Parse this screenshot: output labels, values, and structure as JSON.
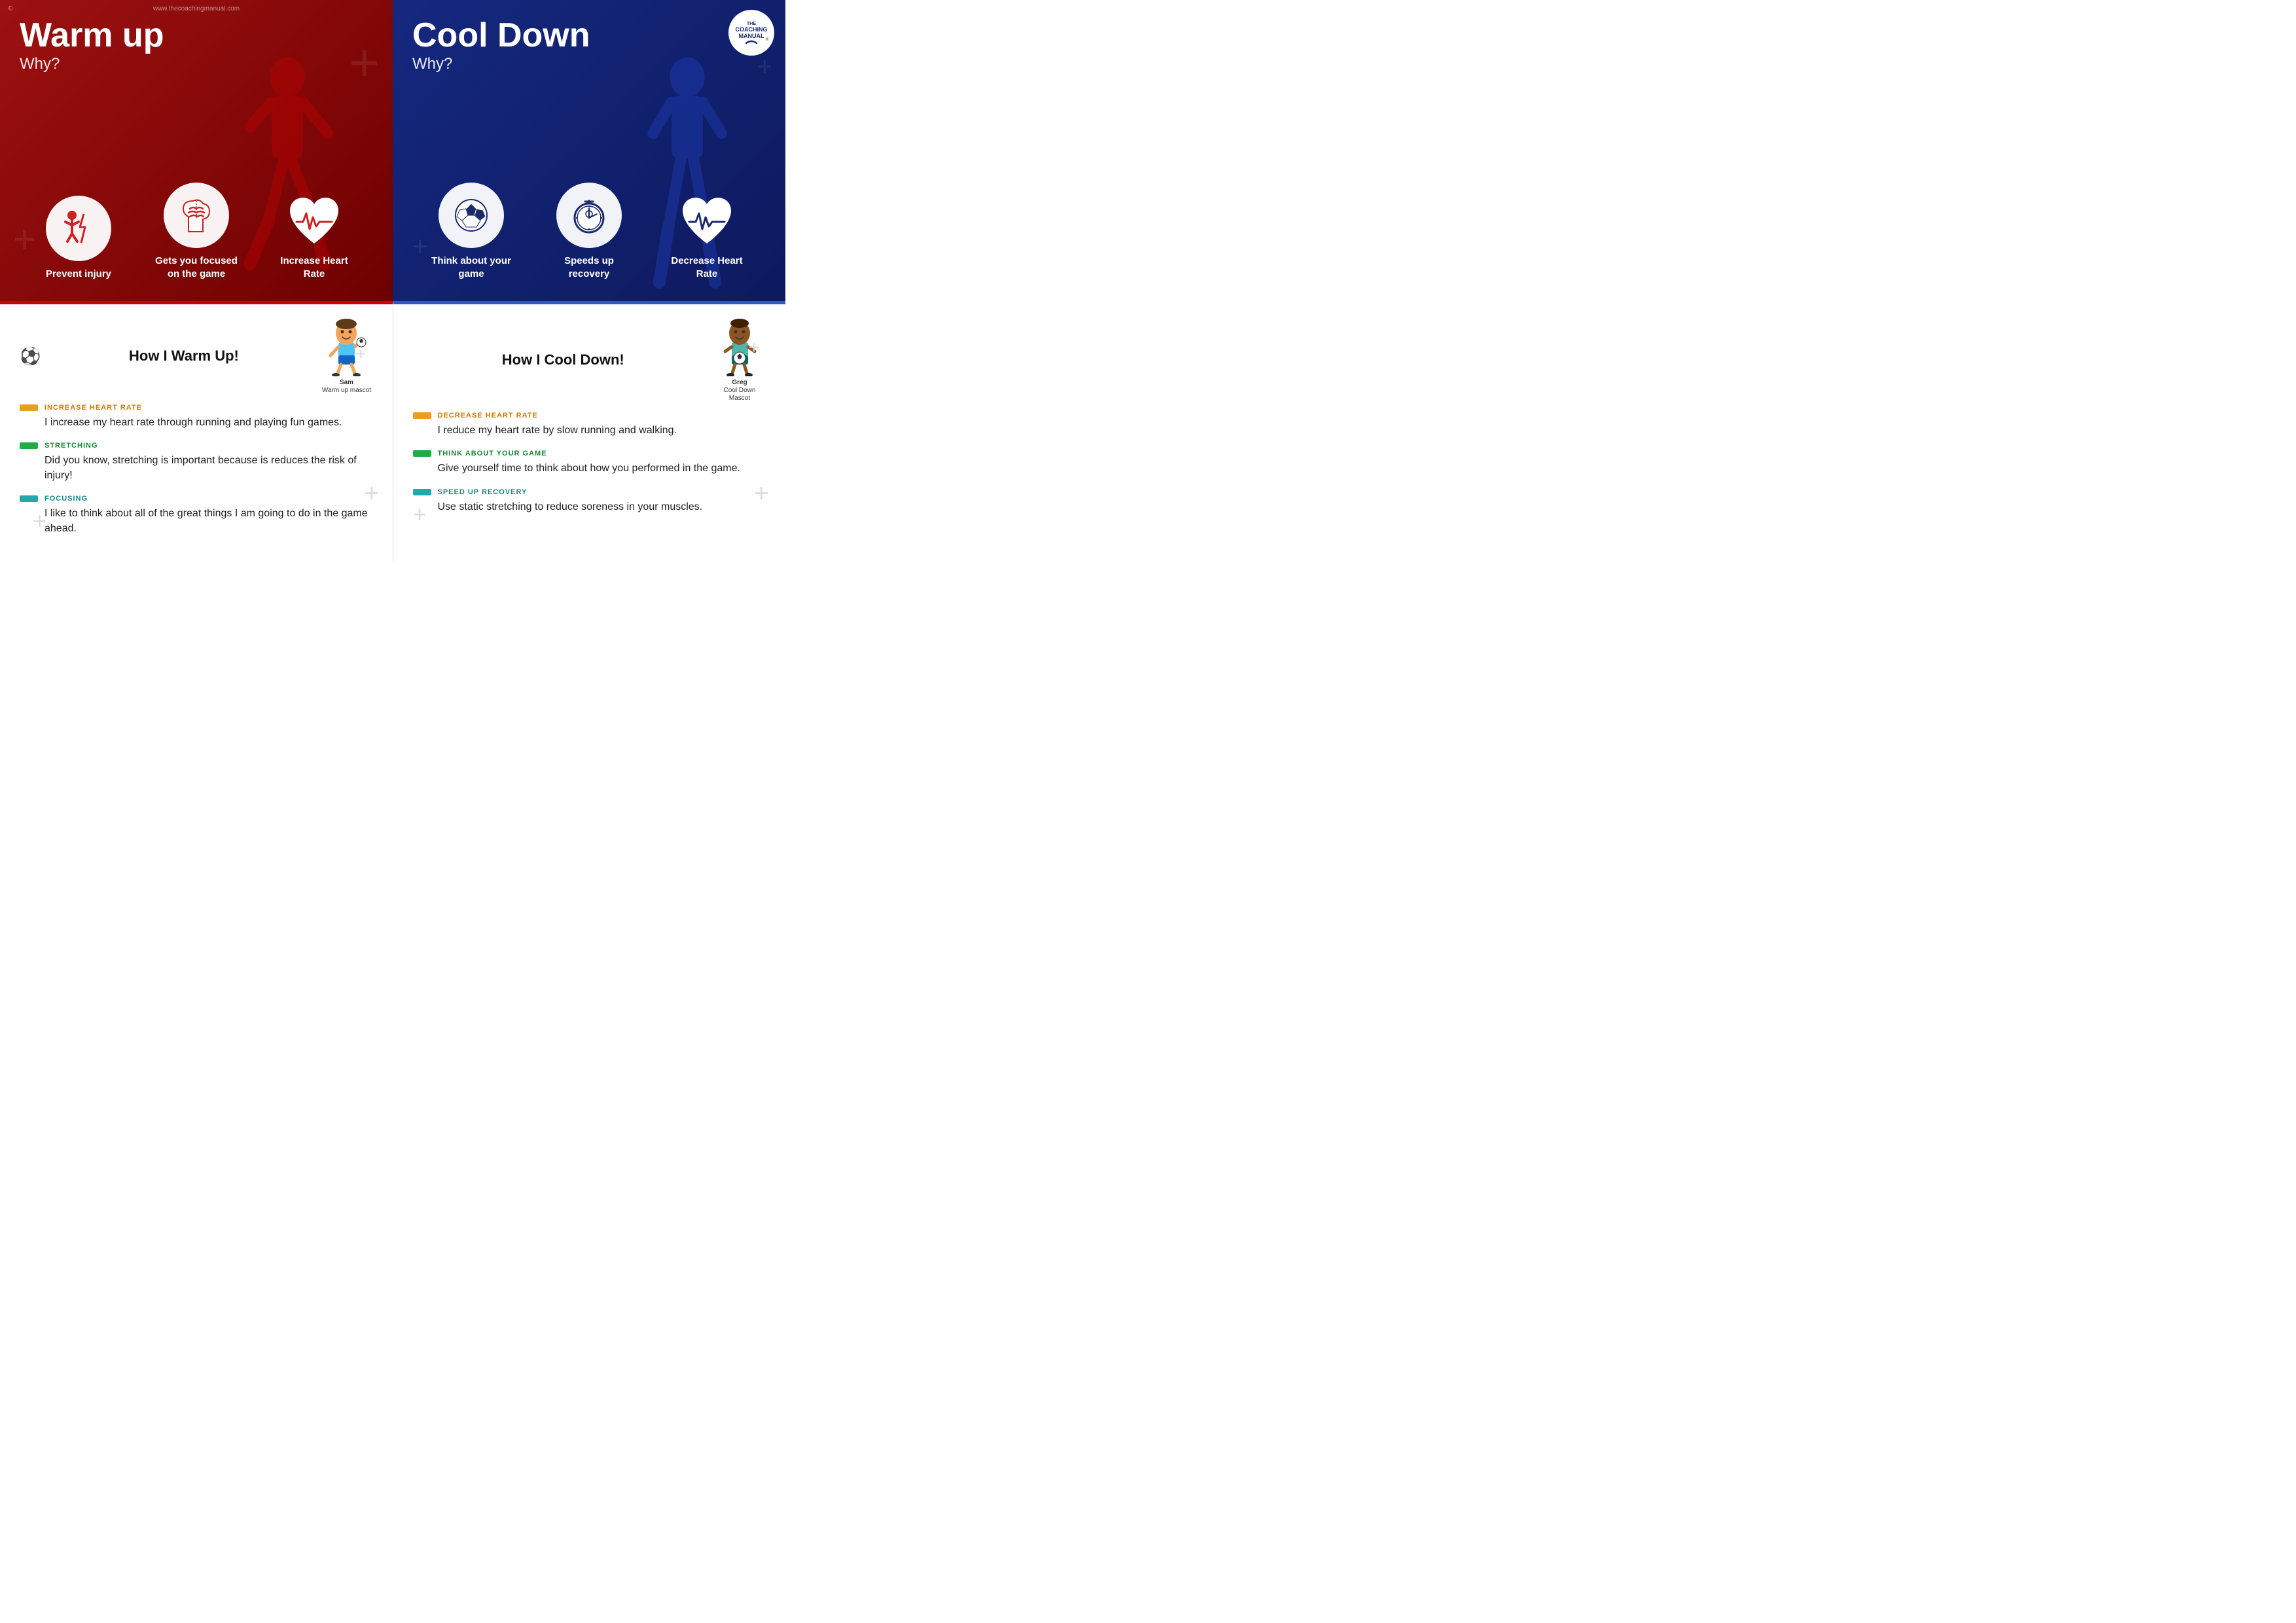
{
  "meta": {
    "watermark": "www.thecoachingmanual.com",
    "copyright": "©"
  },
  "warmUp": {
    "title": "Warm up",
    "subtitle": "Why?",
    "sectionTitle": "How I Warm Up!",
    "icons": [
      {
        "label": "Prevent injury",
        "type": "injury"
      },
      {
        "label": "Gets you focused on the game",
        "type": "brain"
      },
      {
        "label": "Increase Heart Rate",
        "type": "heart"
      }
    ],
    "mascot": {
      "name": "Sam",
      "subtitle": "Warm up mascot"
    },
    "categories": [
      {
        "color": "orange",
        "label": "INCREASE HEART RATE",
        "text": "I increase my heart rate through running and playing fun games."
      },
      {
        "color": "green",
        "label": "STRETCHING",
        "text": "Did you know, stretching is important because is reduces the risk of injury!"
      },
      {
        "color": "teal",
        "label": "FOCUSING",
        "text": "I like to think about all of the great things I am going to do in the game ahead."
      }
    ]
  },
  "coolDown": {
    "title": "Cool Down",
    "subtitle": "Why?",
    "sectionTitle": "How I Cool Down!",
    "icons": [
      {
        "label": "Think about your game",
        "type": "ball"
      },
      {
        "label": "Speeds up recovery",
        "type": "stopwatch"
      },
      {
        "label": "Decrease Heart Rate",
        "type": "heart-blue"
      }
    ],
    "mascot": {
      "name": "Greg",
      "subtitle": "Cool Down Mascot"
    },
    "categories": [
      {
        "color": "orange",
        "label": "DECREASE HEART RATE",
        "text": "I reduce my heart rate by slow running and walking."
      },
      {
        "color": "green",
        "label": "THINK ABOUT YOUR GAME",
        "text": "Give yourself time to think about how you performed in the game."
      },
      {
        "color": "teal",
        "label": "SPEED UP RECOVERY",
        "text": "Use static stretching to reduce soreness in your muscles."
      }
    ]
  }
}
